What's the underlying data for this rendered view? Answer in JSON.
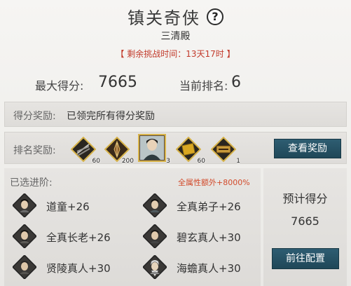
{
  "header": {
    "title": "镇关奇侠",
    "subtitle": "三清殿",
    "time_left": "【 剩余挑战时间：13天17时 】"
  },
  "stats": {
    "max_score_label": "最大得分:",
    "max_score_value": "7665",
    "current_rank_label": "当前排名:",
    "current_rank_value": "6"
  },
  "score_reward": {
    "label": "得分奖励:",
    "text": "已领完所有得分奖励"
  },
  "rank_reward": {
    "label": "排名奖励:",
    "items": [
      {
        "icon": "arrows-bundle-icon",
        "count": "60"
      },
      {
        "icon": "sword-token-icon",
        "count": "200"
      },
      {
        "icon": "hero-portrait-icon",
        "count": "3"
      },
      {
        "icon": "gold-book-icon",
        "count": "60"
      },
      {
        "icon": "scroll-plaque-icon",
        "count": "1"
      }
    ],
    "view_button": "查看奖励"
  },
  "advanced": {
    "label": "已选进阶:",
    "bonus": "全属性额外+8000%",
    "members": [
      {
        "name": "道童+26"
      },
      {
        "name": "全真弟子+26"
      },
      {
        "name": "全真长老+26"
      },
      {
        "name": "碧玄真人+30"
      },
      {
        "name": "贤陵真人+30"
      },
      {
        "name": "海蟾真人+30"
      }
    ]
  },
  "forecast": {
    "label": "预计得分",
    "value": "7665",
    "config_button": "前往配置"
  },
  "colors": {
    "accent_button": "#1f4758",
    "time_text": "#c23a2a",
    "bonus_text": "#d24a2a"
  }
}
